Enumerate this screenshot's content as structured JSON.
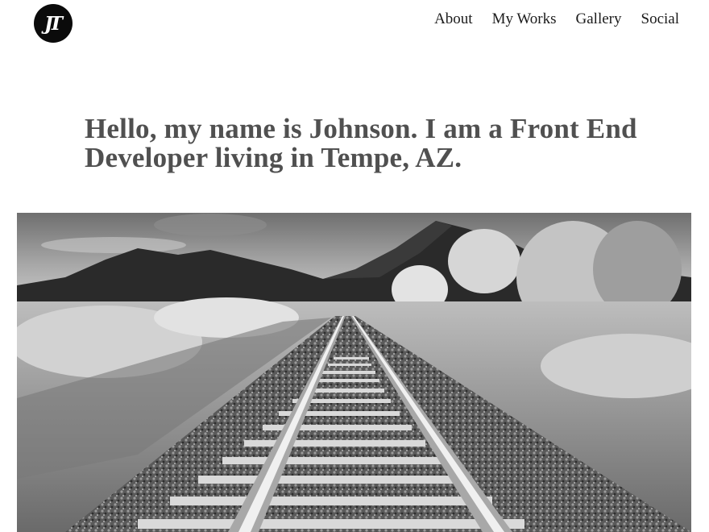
{
  "header": {
    "logo_text": "JT",
    "nav": [
      {
        "label": "About"
      },
      {
        "label": "My Works"
      },
      {
        "label": "Gallery"
      },
      {
        "label": "Social"
      }
    ]
  },
  "hero": {
    "headline": "Hello, my name is Johnson. I am a Front End Developer living in Tempe, AZ."
  },
  "image": {
    "subject": "black-and-white photo of railroad tracks leading toward mountains"
  }
}
